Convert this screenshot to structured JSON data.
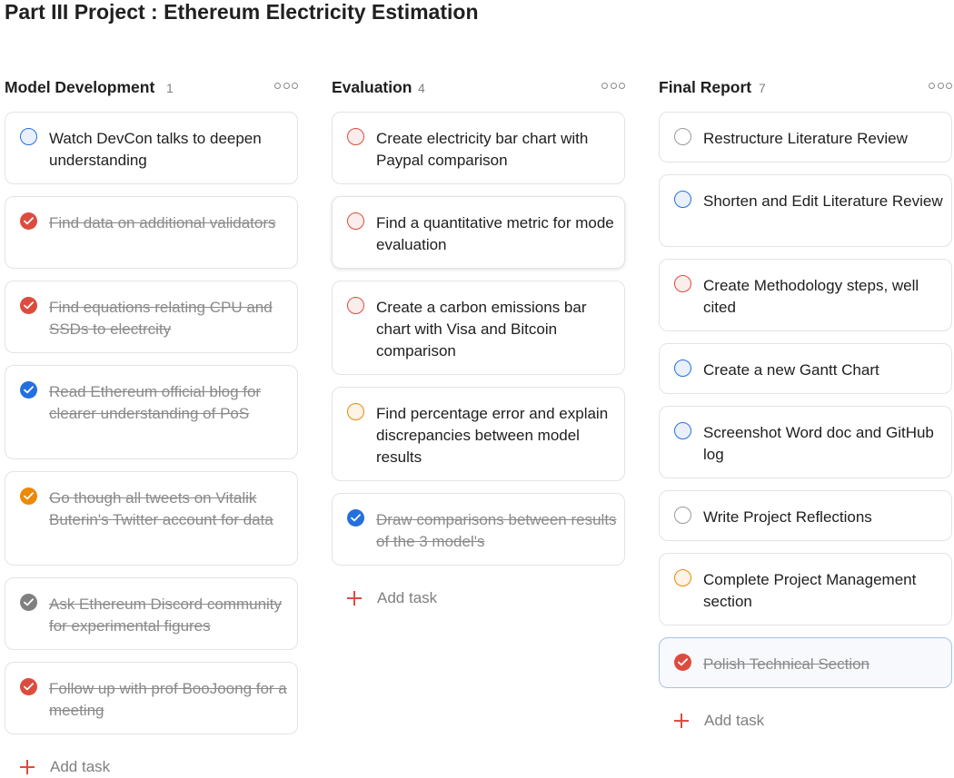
{
  "page": {
    "title": "Part III Project : Ethereum Electricity Estimation"
  },
  "colors": {
    "red": "#dc4c3e",
    "blue": "#246fe0",
    "orange": "#eb8909",
    "grey": "#808080",
    "default": "#999999",
    "add_accent": "#dc4c3e"
  },
  "icons": {
    "column_menu": "more-horizontal-icon",
    "add": "plus-icon",
    "check": "checkmark-icon"
  },
  "columns": [
    {
      "name": "Model Development",
      "count": "1",
      "add_label": "Add task",
      "tasks": [
        {
          "text": "Watch DevCon talks to deepen understanding",
          "done": false,
          "priority": "blue"
        },
        {
          "text": "Find data on additional validators",
          "done": true,
          "priority": "red"
        },
        {
          "text": "Find equations relating CPU and SSDs to electrcity",
          "done": true,
          "priority": "red"
        },
        {
          "text": "Read Ethereum official blog for clearer understanding of PoS",
          "done": true,
          "priority": "blue"
        },
        {
          "text": "Go though all tweets on Vitalik Buterin's Twitter account for data",
          "done": true,
          "priority": "orange"
        },
        {
          "text": "Ask Ethereum Discord community for experimental figures",
          "done": true,
          "priority": "grey"
        },
        {
          "text": "Follow up with prof BooJoong for a meeting",
          "done": true,
          "priority": "red"
        }
      ]
    },
    {
      "name": "Evaluation",
      "count": "4",
      "add_label": "Add task",
      "tasks": [
        {
          "text": "Create electricity bar chart with Paypal comparison",
          "done": false,
          "priority": "red"
        },
        {
          "text": "Find a quantitative metric for mode evaluation",
          "done": false,
          "priority": "red",
          "state": "hovered"
        },
        {
          "text": "Create a carbon emissions bar chart with Visa and Bitcoin comparison",
          "done": false,
          "priority": "red"
        },
        {
          "text": "Find percentage error and explain discrepancies between model results",
          "done": false,
          "priority": "orange"
        },
        {
          "text": "Draw comparisons between results of the 3 model's",
          "done": true,
          "priority": "blue"
        }
      ]
    },
    {
      "name": "Final Report",
      "count": "7",
      "add_label": "Add task",
      "tasks": [
        {
          "text": "Restructure Literature Review",
          "done": false,
          "priority": "default"
        },
        {
          "text": "Shorten and Edit Literature Review",
          "done": false,
          "priority": "blue"
        },
        {
          "text": "Create Methodology steps, well cited",
          "done": false,
          "priority": "red"
        },
        {
          "text": "Create a new Gantt Chart",
          "done": false,
          "priority": "blue"
        },
        {
          "text": "Screenshot Word doc and GitHub log",
          "done": false,
          "priority": "blue"
        },
        {
          "text": "Write Project Reflections",
          "done": false,
          "priority": "default"
        },
        {
          "text": "Complete Project Management section",
          "done": false,
          "priority": "orange"
        },
        {
          "text": "Polish Technical Section",
          "done": true,
          "priority": "red",
          "state": "selected"
        }
      ]
    }
  ]
}
